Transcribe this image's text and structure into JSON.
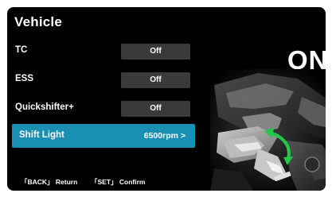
{
  "header": {
    "title": "Vehicle"
  },
  "menu": {
    "items": [
      {
        "label": "TC",
        "value": "Off"
      },
      {
        "label": "ESS",
        "value": "Off"
      },
      {
        "label": "Quickshifter+",
        "value": "Off"
      },
      {
        "label": "Shift Light",
        "value": "6500rpm >"
      }
    ],
    "selected_index": 3
  },
  "footer": {
    "back_hint": "「BACK」 Return",
    "set_hint": "「SET」 Confirm"
  },
  "preview": {
    "status_text": "ON",
    "image": "motorcycle-shift-pedal-illustration",
    "arrow_icon": "bidirectional-arrow-icon"
  },
  "colors": {
    "background": "#000000",
    "selection": "#1a8fb4",
    "value_box": "#3a3a3a",
    "arrow": "#21c84a"
  }
}
